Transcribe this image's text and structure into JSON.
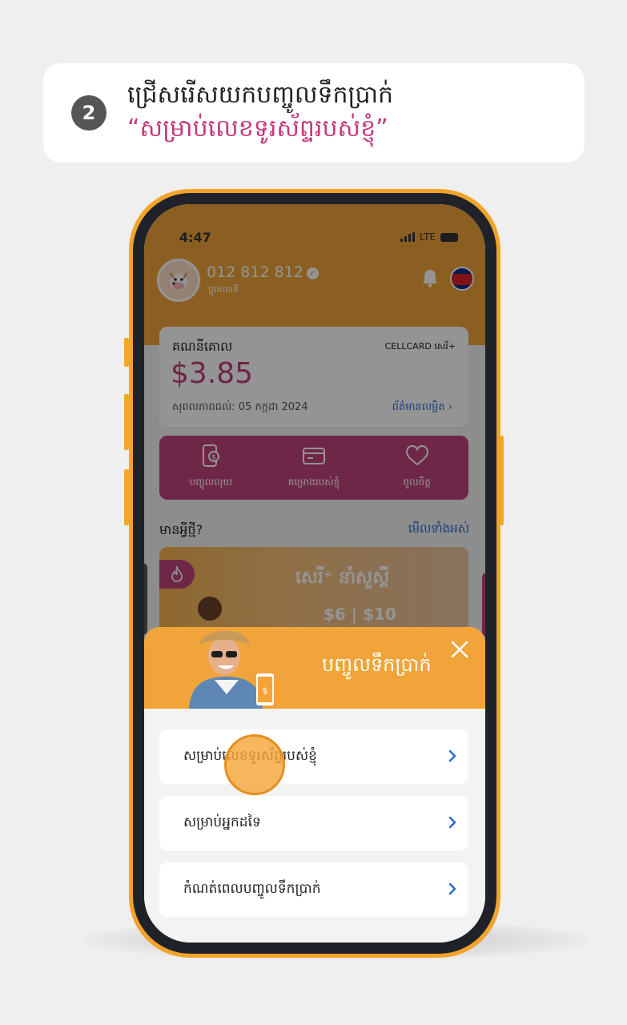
{
  "step": {
    "number": "2",
    "line1": "ជ្រើសរើសយកបញ្ចូលទឹកប្រាក់",
    "line2": "“សម្រាប់លេខទូរស័ព្ទរបស់ខ្ញុំ”"
  },
  "status_bar": {
    "time": "4:47",
    "network": "LTE"
  },
  "profile": {
    "phone_number": "012 812 812",
    "subtitle": "ប្តូរគណនី"
  },
  "balance": {
    "label": "គណនីគោល",
    "plan": "CELLCARD សេរី+",
    "amount": "$3.85",
    "validity": "សុពលភាពដល់: 05 កក្កដា 2024",
    "details_link": "ព័ត៌មានលម្អិត"
  },
  "quick_actions": [
    {
      "label": "បញ្ចូលលុយ",
      "icon": "topup-phone-icon"
    },
    {
      "label": "គម្រោងរបស់ខ្ញុំ",
      "icon": "wallet-card-icon"
    },
    {
      "label": "ចូលចិត្ត",
      "icon": "heart-icon"
    }
  ],
  "news": {
    "title": "មានអ្វីថ្មី?",
    "see_all": "មើលទាំងអស់",
    "banner_text": "សេរី⁺ នាំសួស្តី",
    "banner_price": "$6 | $10"
  },
  "sheet": {
    "title": "បញ្ចូលទឹកប្រាក់",
    "options": [
      "សម្រាប់លេខទូរស័ព្ទរបស់ខ្ញុំ",
      "សម្រាប់អ្នកដទៃ",
      "កំណត់ពេលបញ្ចូលទឹកប្រាក់"
    ]
  },
  "colors": {
    "brand_orange": "#f0a43a",
    "brand_magenta": "#c0447b",
    "link_blue": "#2f6bd1",
    "step_highlight": "#c4387a"
  }
}
